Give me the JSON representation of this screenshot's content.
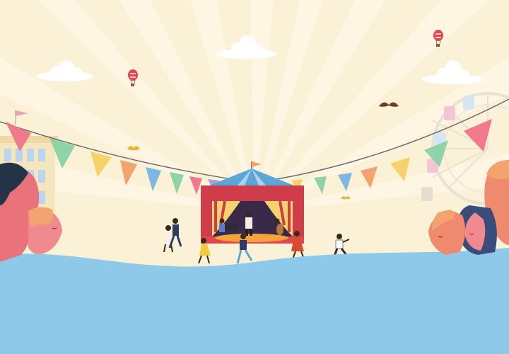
{
  "scene": {
    "description_visible_text": [],
    "colors": {
      "sky": "#fbf1d6",
      "sky_ray": "#fff8e6",
      "ground": "#8ec9ea",
      "ground_shadow": "#7cbbe1",
      "tent_red": "#cf3c4a",
      "tent_yellow": "#f7c846",
      "tent_blue": "#5aa6d8",
      "pennant_green": "#8fd3a8",
      "pennant_yellow": "#f6d36a",
      "pennant_orange": "#f2a36e",
      "pennant_pink": "#e6737b",
      "pennant_blue": "#7fb7e3",
      "pennant_purple": "#b49be0"
    },
    "icons": [
      "sun-rays",
      "cloud-icon",
      "hot-air-balloon-icon",
      "bird-icon",
      "bunting-pennant",
      "circus-tent",
      "ferris-wheel",
      "building",
      "person-faces",
      "dancer-figures"
    ]
  }
}
